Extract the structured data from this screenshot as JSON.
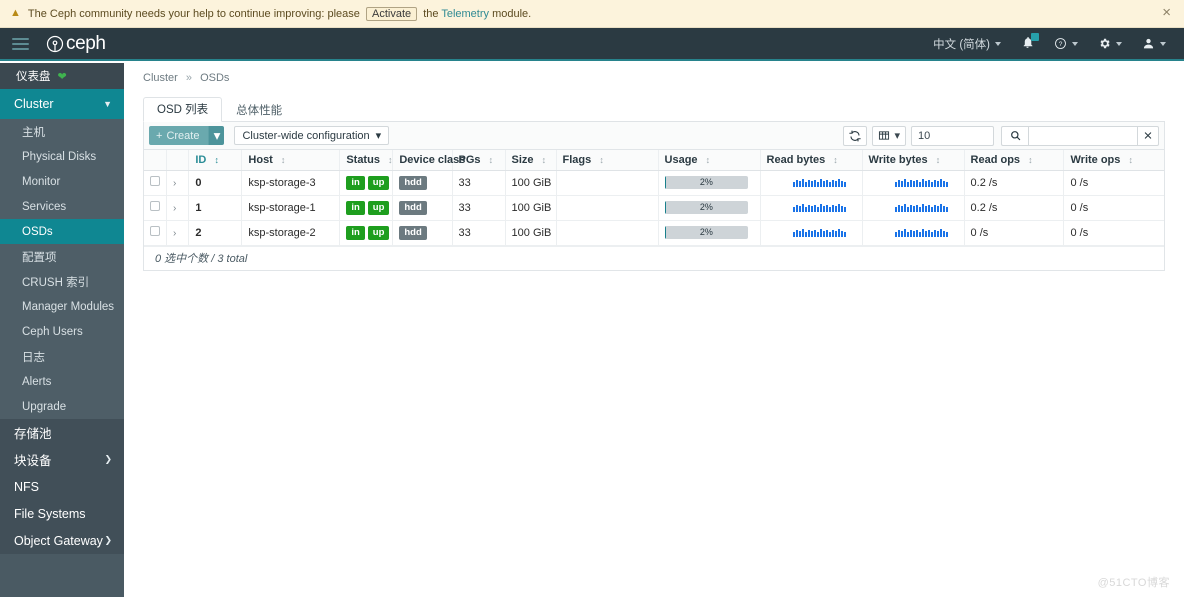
{
  "alert": {
    "icon": "warning-triangle-icon",
    "text_before": "The Ceph community needs your help to continue improving: please",
    "button_label": "Activate",
    "text_middle": "the",
    "link_label": "Telemetry",
    "text_after": "module.",
    "close_label": "×"
  },
  "navbar": {
    "brand": "ceph",
    "menu_icon": "hamburger-icon",
    "language": "中文 (简体)",
    "notifications_icon": "bell-icon",
    "help_icon": "help-circle-icon",
    "settings_icon": "gear-icon",
    "user_icon": "user-icon"
  },
  "sidebar": {
    "dashboard": {
      "label": "仪表盘",
      "status_icon": "heart-icon"
    },
    "cluster": {
      "label": "Cluster",
      "expanded": true
    },
    "cluster_items": [
      {
        "label": "主机",
        "selected": false
      },
      {
        "label": "Physical Disks",
        "selected": false
      },
      {
        "label": "Monitor",
        "selected": false
      },
      {
        "label": "Services",
        "selected": false
      },
      {
        "label": "OSDs",
        "selected": true
      },
      {
        "label": "配置项",
        "selected": false
      },
      {
        "label": "CRUSH 索引",
        "selected": false
      },
      {
        "label": "Manager Modules",
        "selected": false
      },
      {
        "label": "Ceph Users",
        "selected": false
      },
      {
        "label": "日志",
        "selected": false
      },
      {
        "label": "Alerts",
        "selected": false
      },
      {
        "label": "Upgrade",
        "selected": false
      }
    ],
    "roots": [
      {
        "label": "存储池",
        "has_chevron": false
      },
      {
        "label": "块设备",
        "has_chevron": true
      },
      {
        "label": "NFS",
        "has_chevron": false
      },
      {
        "label": "File Systems",
        "has_chevron": false
      },
      {
        "label": "Object Gateway",
        "has_chevron": true
      }
    ]
  },
  "breadcrumb": {
    "parent": "Cluster",
    "separator": "»",
    "current": "OSDs"
  },
  "tabs": [
    {
      "label": "OSD 列表",
      "active": true
    },
    {
      "label": "总体性能",
      "active": false
    }
  ],
  "toolbar": {
    "create_label": "Create",
    "create_plus": "+",
    "create_caret": "▾",
    "cluster_config_label": "Cluster-wide configuration",
    "cluster_config_caret": "▾",
    "refresh_icon": "refresh-icon",
    "columns_icon": "table-columns-icon",
    "columns_caret": "▾",
    "page_size_value": "10",
    "search_icon": "search-icon",
    "search_value": "",
    "search_placeholder": "",
    "clear_icon": "close-x-icon"
  },
  "table": {
    "columns": [
      {
        "key": "check",
        "label": ""
      },
      {
        "key": "expand",
        "label": ""
      },
      {
        "key": "id",
        "label": "ID",
        "sorted": true
      },
      {
        "key": "host",
        "label": "Host",
        "sorted": false
      },
      {
        "key": "status",
        "label": "Status",
        "sorted": false
      },
      {
        "key": "device_class",
        "label": "Device class",
        "sorted": false
      },
      {
        "key": "pgs",
        "label": "PGs",
        "sorted": false
      },
      {
        "key": "size",
        "label": "Size",
        "sorted": false
      },
      {
        "key": "flags",
        "label": "Flags",
        "sorted": false
      },
      {
        "key": "usage",
        "label": "Usage",
        "sorted": false
      },
      {
        "key": "read_bytes",
        "label": "Read bytes",
        "sorted": false
      },
      {
        "key": "write_bytes",
        "label": "Write bytes",
        "sorted": false
      },
      {
        "key": "read_ops",
        "label": "Read ops",
        "sorted": false
      },
      {
        "key": "write_ops",
        "label": "Write ops",
        "sorted": false
      }
    ],
    "rows": [
      {
        "id": "0",
        "host": "ksp-storage-3",
        "status": [
          "in",
          "up"
        ],
        "device_class": "hdd",
        "pgs": "33",
        "size": "100 GiB",
        "flags": "",
        "usage_percent": 2,
        "usage_label": "2%",
        "read_ops": "0.2 /s",
        "write_ops": "0 /s"
      },
      {
        "id": "1",
        "host": "ksp-storage-1",
        "status": [
          "in",
          "up"
        ],
        "device_class": "hdd",
        "pgs": "33",
        "size": "100 GiB",
        "flags": "",
        "usage_percent": 2,
        "usage_label": "2%",
        "read_ops": "0.2 /s",
        "write_ops": "0 /s"
      },
      {
        "id": "2",
        "host": "ksp-storage-2",
        "status": [
          "in",
          "up"
        ],
        "device_class": "hdd",
        "pgs": "33",
        "size": "100 GiB",
        "flags": "",
        "usage_percent": 2,
        "usage_label": "2%",
        "read_ops": "0 /s",
        "write_ops": "0 /s"
      }
    ],
    "footer": "0 选中个数 / 3 total"
  },
  "watermark": "@51CTO博客",
  "colors": {
    "brand_teal": "#0f8792",
    "navbar_bg": "#2b3a42",
    "sidebar_bg": "#4a5a63",
    "status_green": "#1e9e1e",
    "device_gray": "#6c7a80",
    "usage_fill": "#18808c",
    "sparkline_blue": "#1a73e8",
    "alert_bg": "#fcf3dc"
  }
}
